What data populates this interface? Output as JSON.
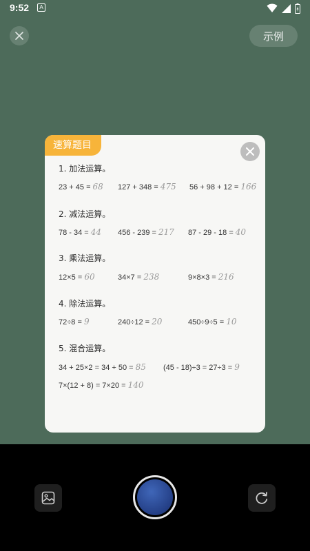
{
  "status": {
    "time": "9:52",
    "notification_glyph": "A"
  },
  "top": {
    "example_label": "示例"
  },
  "card": {
    "tag": "速算题目",
    "sections": [
      {
        "title": "1. 加法运算。",
        "rows": [
          [
            {
              "q": "23 + 45 = ",
              "a": "68"
            },
            {
              "q": "127 + 348 = ",
              "a": "475"
            },
            {
              "q": "56 + 98 + 12 = ",
              "a": "166"
            }
          ]
        ]
      },
      {
        "title": "2. 减法运算。",
        "rows": [
          [
            {
              "q": "78 - 34 = ",
              "a": "44"
            },
            {
              "q": "456 - 239 = ",
              "a": "217"
            },
            {
              "q": "87 - 29 - 18 = ",
              "a": "40"
            }
          ]
        ]
      },
      {
        "title": "3. 乘法运算。",
        "rows": [
          [
            {
              "q": "12×5 = ",
              "a": "60"
            },
            {
              "q": "34×7 = ",
              "a": "238"
            },
            {
              "q": "9×8×3 = ",
              "a": "216"
            }
          ]
        ]
      },
      {
        "title": "4. 除法运算。",
        "rows": [
          [
            {
              "q": "72÷8 = ",
              "a": "9"
            },
            {
              "q": "240÷12 = ",
              "a": "20"
            },
            {
              "q": "450÷9÷5 = ",
              "a": "10"
            }
          ]
        ]
      },
      {
        "title": "5. 混合运算。",
        "rows": [
          [
            {
              "q": "34 + 25×2 = 34 + 50 = ",
              "a": "85"
            },
            {
              "q": "(45 - 18)÷3 = 27÷3 = ",
              "a": "9"
            }
          ],
          [
            {
              "q": "7×(12 + 8) = 7×20 = ",
              "a": "140"
            }
          ]
        ]
      }
    ]
  },
  "colors": {
    "background": "#4d6b5a",
    "tag": "#f7b43a",
    "shutter": "#2f4f9c"
  },
  "icons": [
    "close-icon",
    "gallery-icon",
    "rotate-icon",
    "wifi-icon",
    "signal-icon",
    "battery-icon"
  ]
}
